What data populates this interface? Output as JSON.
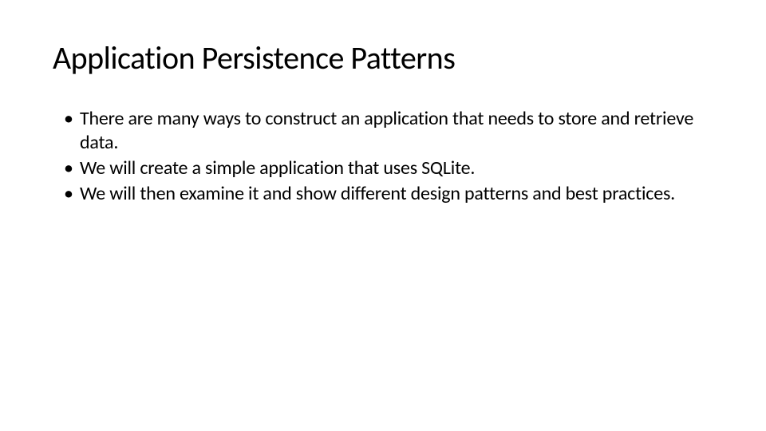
{
  "slide": {
    "title": "Application Persistence Patterns",
    "bullets": [
      "There are many ways to construct an application that needs to store and retrieve data.",
      "We will create a simple application that uses SQLite.",
      "We will then examine it and show different design patterns and best practices."
    ]
  }
}
